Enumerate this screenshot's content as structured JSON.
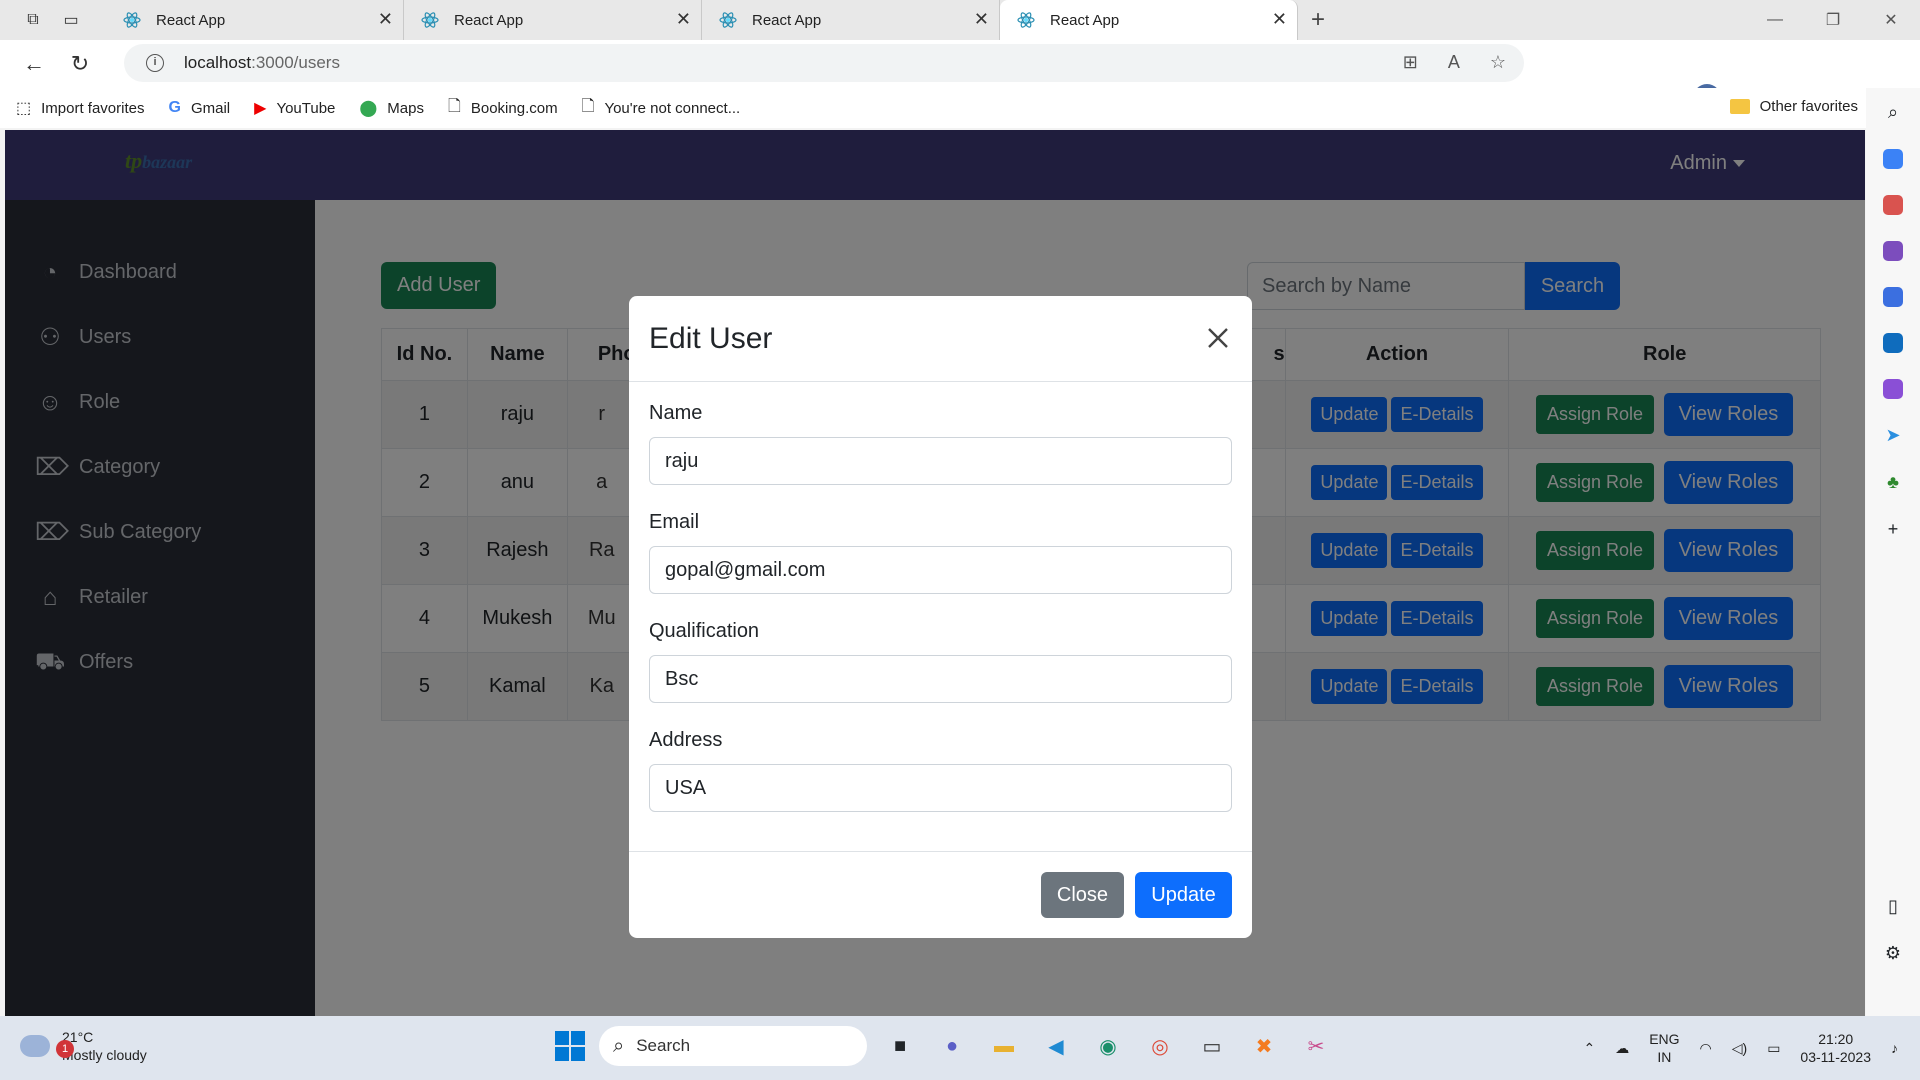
{
  "browser": {
    "tabs": [
      {
        "title": "React App",
        "active": false
      },
      {
        "title": "React App",
        "active": false
      },
      {
        "title": "React App",
        "active": false
      },
      {
        "title": "React App",
        "active": true
      }
    ],
    "url_host": "localhost",
    "url_path": ":3000/users",
    "favorites": [
      {
        "label": "Import favorites",
        "icon": "import-icon"
      },
      {
        "label": "Gmail",
        "icon": "google-icon"
      },
      {
        "label": "YouTube",
        "icon": "youtube-icon"
      },
      {
        "label": "Maps",
        "icon": "maps-pin-icon"
      },
      {
        "label": "Booking.com",
        "icon": "page-icon"
      },
      {
        "label": "You're not connect...",
        "icon": "page-icon"
      }
    ],
    "other_favorites": "Other favorites"
  },
  "app": {
    "logo_text_a": "tp",
    "logo_text_b": "bazaar",
    "admin_label": "Admin",
    "sidebar": [
      {
        "label": "Dashboard",
        "icon": "gauge-icon"
      },
      {
        "label": "Users",
        "icon": "users-icon"
      },
      {
        "label": "Role",
        "icon": "user-icon"
      },
      {
        "label": "Category",
        "icon": "tag-icon"
      },
      {
        "label": "Sub Category",
        "icon": "tags-icon"
      },
      {
        "label": "Retailer",
        "icon": "store-icon"
      },
      {
        "label": "Offers",
        "icon": "cart-icon"
      }
    ],
    "add_user_label": "Add User",
    "search_placeholder": "Search by Name",
    "search_button": "Search",
    "table": {
      "headers": [
        "Id No.",
        "Name",
        "Pho",
        "s",
        "Action",
        "Role"
      ],
      "rows": [
        {
          "id": "1",
          "name": "raju",
          "photo_alt": "r"
        },
        {
          "id": "2",
          "name": "anu",
          "photo_alt": "a"
        },
        {
          "id": "3",
          "name": "Rajesh",
          "photo_alt": "Ra"
        },
        {
          "id": "4",
          "name": "Mukesh",
          "photo_alt": "Mu"
        },
        {
          "id": "5",
          "name": "Kamal",
          "photo_alt": "Ka"
        }
      ],
      "update_label": "Update",
      "details_label": "E-Details",
      "assign_label": "Assign Role",
      "view_label": "View Roles"
    }
  },
  "modal": {
    "title": "Edit User",
    "name_label": "Name",
    "name_value": "raju",
    "email_label": "Email",
    "email_value": "gopal@gmail.com",
    "qualification_label": "Qualification",
    "qualification_value": "Bsc",
    "address_label": "Address",
    "address_value": "USA",
    "close_label": "Close",
    "update_label": "Update"
  },
  "taskbar": {
    "notification_count": "1",
    "temperature": "21°C",
    "weather": "Mostly cloudy",
    "search_label": "Search",
    "lang_a": "ENG",
    "lang_b": "IN",
    "time": "21:20",
    "date": "03-11-2023"
  },
  "colors": {
    "header_bg": "#3f3b7a",
    "sidebar_bg": "#2b2e38",
    "primary": "#0d6efd",
    "success": "#198754",
    "secondary": "#6c757d"
  }
}
